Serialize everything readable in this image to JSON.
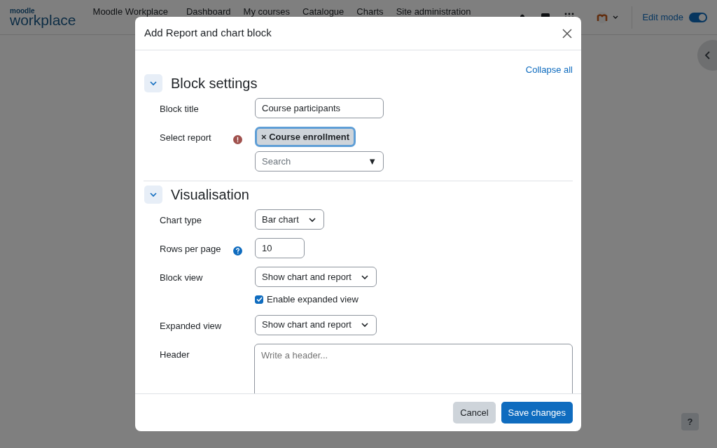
{
  "navbar": {
    "logo_top": "moodle",
    "logo_main": "workplace",
    "site_name": "Moodle Workplace",
    "nav_items": [
      "Dashboard",
      "My courses",
      "Catalogue",
      "Charts",
      "Site administration"
    ],
    "edit_mode": {
      "label": "Edit mode",
      "on": true
    }
  },
  "modal": {
    "title": "Add Report and chart block",
    "collapse_all": "Collapse all",
    "sections": [
      {
        "title": "Block settings",
        "expanded": true,
        "fields": [
          {
            "kind": "text",
            "label": "Block title",
            "value": "Course participants"
          },
          {
            "kind": "autocomplete",
            "label": "Select report",
            "required": true,
            "tag": "× Course enrollment",
            "placeholder": "Search",
            "arrow": "▼"
          }
        ]
      },
      {
        "title": "Visualisation",
        "expanded": true,
        "fields": [
          {
            "kind": "select",
            "label": "Chart type",
            "value": "Bar chart"
          },
          {
            "kind": "number",
            "label": "Rows per page",
            "help": true,
            "value": "10"
          },
          {
            "kind": "select",
            "label": "Block view",
            "value": "Show chart and report"
          },
          {
            "kind": "checkbox",
            "label": "Enable expanded view",
            "checked": true
          },
          {
            "kind": "select",
            "label": "Expanded view",
            "value": "Show chart and report"
          },
          {
            "kind": "textarea",
            "label": "Header",
            "placeholder": "Write a header..."
          }
        ]
      }
    ],
    "buttons": [
      {
        "label": "Cancel",
        "kind": "secondary"
      },
      {
        "label": "Save changes",
        "kind": "primary"
      }
    ]
  },
  "help_button": "?"
}
